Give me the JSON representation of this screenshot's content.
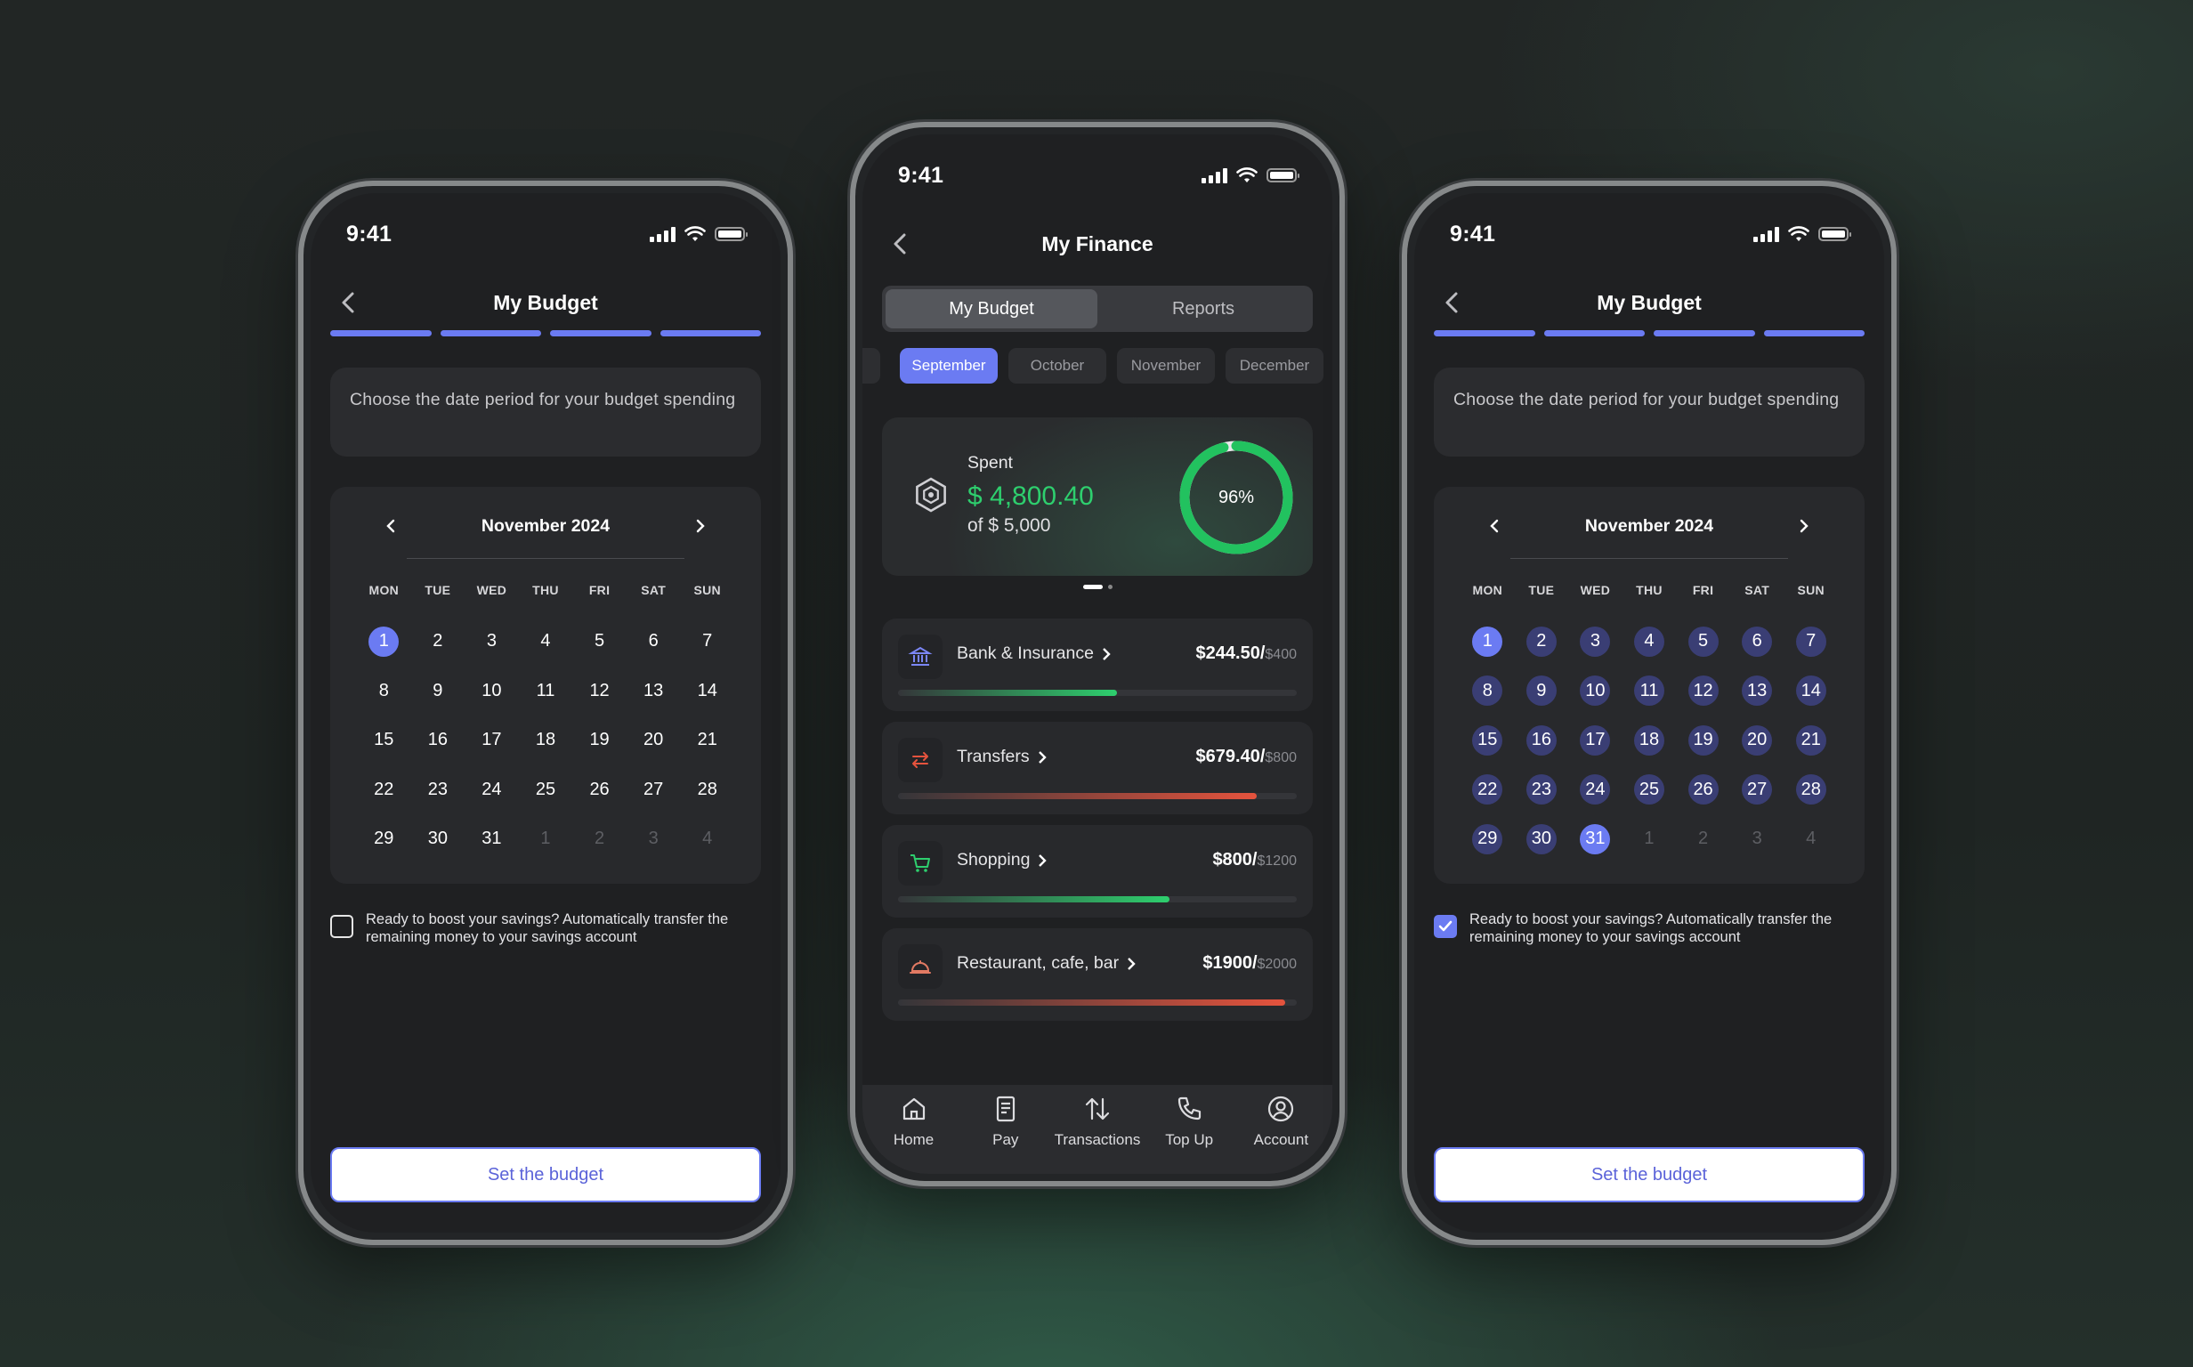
{
  "status": {
    "time": "9:41"
  },
  "budget_screen": {
    "title": "My Budget",
    "prompt": "Choose the date period for your budget spending",
    "month": "November 2024",
    "weekdays": [
      "MON",
      "TUE",
      "WED",
      "THU",
      "FRI",
      "SAT",
      "SUN"
    ],
    "days": [
      "1",
      "2",
      "3",
      "4",
      "5",
      "6",
      "7",
      "8",
      "9",
      "10",
      "11",
      "12",
      "13",
      "14",
      "15",
      "16",
      "17",
      "18",
      "19",
      "20",
      "21",
      "22",
      "23",
      "24",
      "25",
      "26",
      "27",
      "28",
      "29",
      "30",
      "31",
      "1",
      "2",
      "3",
      "4"
    ],
    "savings_text": "Ready to boost your savings? Automatically transfer the remaining money to your savings account",
    "cta": "Set the budget"
  },
  "finance_screen": {
    "title": "My Finance",
    "tabs": [
      "My Budget",
      "Reports"
    ],
    "months": [
      "September",
      "October",
      "November",
      "December"
    ],
    "spent": {
      "label": "Spent",
      "amount": "$ 4,800.40",
      "of": "of $ 5,000",
      "percent": "96%",
      "progress": 0.96
    },
    "categories": [
      {
        "name": "Bank & Insurance",
        "spent": "$244.50/",
        "limit": "$400",
        "progress": 0.55,
        "color": "#2ecf6e"
      },
      {
        "name": "Transfers",
        "spent": "$679.40/",
        "limit": "$800",
        "progress": 0.9,
        "color": "#e5533d"
      },
      {
        "name": "Shopping",
        "spent": "$800/",
        "limit": "$1200",
        "progress": 0.68,
        "color": "#2ecf6e"
      },
      {
        "name": "Restaurant, cafe, bar",
        "spent": "$1900/",
        "limit": "$2000",
        "progress": 0.97,
        "color": "#e5533d"
      }
    ],
    "nav": [
      "Home",
      "Pay",
      "Transactions",
      "Top Up",
      "Account"
    ]
  },
  "colors": {
    "accent": "#6b7bf2",
    "positive": "#2ecf6e",
    "negative": "#e5533d"
  }
}
